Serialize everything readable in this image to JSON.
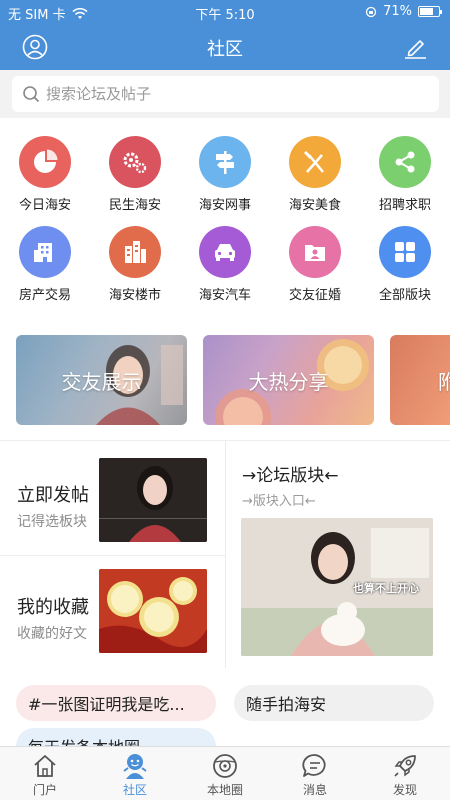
{
  "status_bar": {
    "carrier": "无 SIM 卡",
    "time": "下午 5:10",
    "battery": "71%",
    "battery_level": 0.71
  },
  "header": {
    "title": "社区"
  },
  "search": {
    "placeholder": "搜索论坛及帖子"
  },
  "categories": [
    {
      "label": "今日海安",
      "icon": "pie-chart-icon",
      "color": "#e8625e"
    },
    {
      "label": "民生海安",
      "icon": "gears-icon",
      "color": "#d9545f"
    },
    {
      "label": "海安网事",
      "icon": "signpost-icon",
      "color": "#6bb4ee"
    },
    {
      "label": "海安美食",
      "icon": "fork-knife-icon",
      "color": "#f3a93a"
    },
    {
      "label": "招聘求职",
      "icon": "share-icon",
      "color": "#7ccf6e"
    },
    {
      "label": "房产交易",
      "icon": "building-icon",
      "color": "#6e8ff0"
    },
    {
      "label": "海安楼市",
      "icon": "city-icon",
      "color": "#e16c4c"
    },
    {
      "label": "海安汽车",
      "icon": "car-icon",
      "color": "#a55ad6"
    },
    {
      "label": "交友征婚",
      "icon": "contact-folder-icon",
      "color": "#e772a5"
    },
    {
      "label": "全部版块",
      "icon": "grid-icon",
      "color": "#4e8ff0"
    }
  ],
  "banners": [
    {
      "text": "交友展示"
    },
    {
      "text": "大热分享"
    },
    {
      "text": "附"
    }
  ],
  "features": {
    "post": {
      "title": "立即发帖",
      "subtitle": "记得选板块"
    },
    "favorites": {
      "title": "我的收藏",
      "subtitle": "收藏的好文"
    },
    "forum": {
      "title": "→论坛版块←",
      "subtitle": "→版块入口←",
      "image_caption": "也算不上开心"
    }
  },
  "topics": [
    {
      "text": "#一张图证明我是吃..."
    },
    {
      "text": "随手拍海安"
    },
    {
      "text": "每天发条本地圈"
    }
  ],
  "tabs": [
    {
      "label": "门户",
      "icon": "home-icon",
      "active": false
    },
    {
      "label": "社区",
      "icon": "community-icon",
      "active": true
    },
    {
      "label": "本地圈",
      "icon": "local-circle-icon",
      "active": false
    },
    {
      "label": "消息",
      "icon": "message-icon",
      "active": false
    },
    {
      "label": "发现",
      "icon": "rocket-icon",
      "active": false
    }
  ]
}
